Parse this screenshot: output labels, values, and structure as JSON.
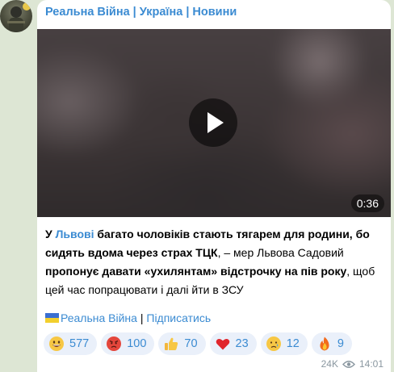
{
  "channel": {
    "title": "Реальна Війна | Україна | Новини"
  },
  "video": {
    "duration": "0:36",
    "play_icon": "play-icon"
  },
  "message": {
    "segments": [
      {
        "text": "У ",
        "style": "bold"
      },
      {
        "text": "Львові",
        "style": "link"
      },
      {
        "text": " багато чоловіків стають тягарем для родини, бо сидять вдома через страх ТЦК",
        "style": "bold"
      },
      {
        "text": ", – мер Львова Садовий ",
        "style": "normal"
      },
      {
        "text": "пропонує давати «ухилянтам» відстрочку на пів року",
        "style": "bold"
      },
      {
        "text": ", щоб цей час попрацювати і далі йти в ЗСУ",
        "style": "normal"
      }
    ]
  },
  "footer": {
    "channel_link": "Реальна Війна",
    "separator": "|",
    "subscribe_link": "Підписатись",
    "flag_icon": "ukraine-flag-icon"
  },
  "reactions": [
    {
      "emoji": "grinning-face-icon",
      "count": "577"
    },
    {
      "emoji": "angry-face-icon",
      "count": "100"
    },
    {
      "emoji": "thumbs-up-icon",
      "count": "70"
    },
    {
      "emoji": "red-heart-icon",
      "count": "23"
    },
    {
      "emoji": "crying-face-icon",
      "count": "12"
    },
    {
      "emoji": "fire-icon",
      "count": "9"
    }
  ],
  "meta": {
    "views": "24K",
    "time": "14:01",
    "views_icon": "eye-icon"
  },
  "colors": {
    "accent": "#3b8bd2",
    "background": "#dde6d4",
    "bubble": "#ffffff",
    "reaction_bg": "#eaf0fa",
    "meta": "#8a97a0"
  }
}
